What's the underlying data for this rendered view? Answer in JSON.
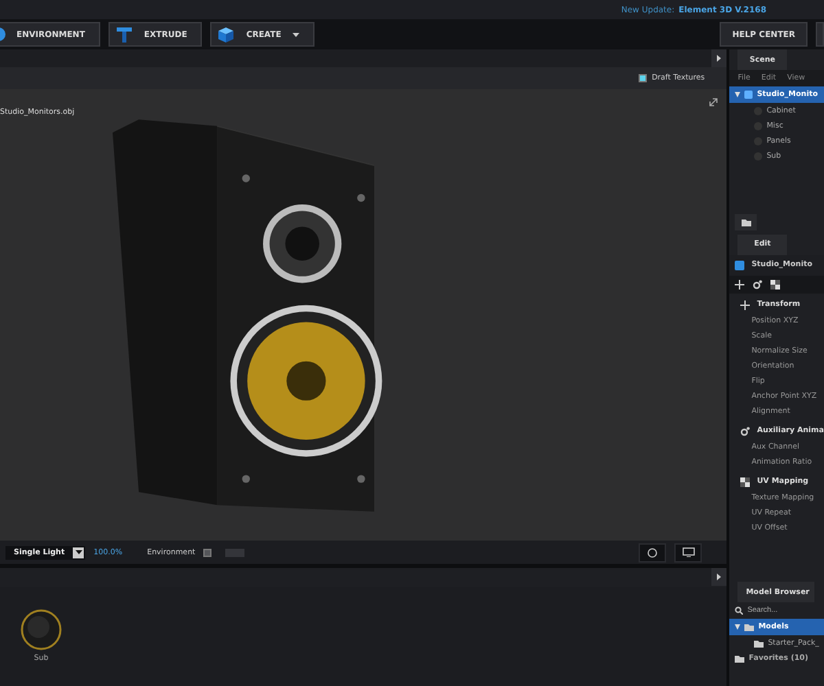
{
  "update": {
    "label": "New Update:",
    "version": "Element 3D V.2168"
  },
  "toolbar": [
    {
      "label": "ENVIRONMENT",
      "kind": "globe",
      "dropdown": false
    },
    {
      "label": "EXTRUDE",
      "kind": "extrude",
      "dropdown": false
    },
    {
      "label": "CREATE",
      "kind": "cube",
      "dropdown": true
    }
  ],
  "help": "HELP CENTER",
  "viewport": {
    "draft_textures": {
      "label": "Draft Textures",
      "checked": true
    },
    "object_label": "Studio_Monitors.obj",
    "light": "Single Light",
    "intensity": "100.0%",
    "environment": {
      "label": "Environment",
      "checked": false
    }
  },
  "materials": [
    {
      "name": "Sub"
    }
  ],
  "scene": {
    "tab": "Scene",
    "menu": [
      "File",
      "Edit",
      "View"
    ],
    "tree": [
      {
        "label": "Studio_Monito",
        "selected": true,
        "expanded": true,
        "children": [
          {
            "label": "Cabinet",
            "selected": false
          },
          {
            "label": "Misc",
            "selected": false
          },
          {
            "label": "Panels",
            "selected": false
          },
          {
            "label": "Sub",
            "selected": false
          }
        ]
      }
    ]
  },
  "edit": {
    "tab": "Edit",
    "object": "Studio_Monito",
    "sections": [
      {
        "title": "Transform",
        "kind": "move",
        "items": [
          "Position XYZ",
          "Scale",
          "Normalize Size",
          "Orientation",
          "Flip",
          "Anchor Point XYZ",
          "Alignment"
        ]
      },
      {
        "title": "Auxiliary Anima",
        "kind": "gears",
        "items": [
          "Aux Channel",
          "Animation Ratio"
        ]
      },
      {
        "title": "UV Mapping",
        "kind": "checker",
        "items": [
          "Texture Mapping",
          "UV Repeat",
          "UV Offset"
        ]
      }
    ]
  },
  "model_browser": {
    "tab": "Model Browser",
    "placeholder": "Search...",
    "tree": [
      {
        "label": "Models",
        "selected": true,
        "expanded": true,
        "children": [
          {
            "label": "Starter_Pack_",
            "selected": false
          }
        ]
      },
      {
        "label": "Favorites (10)",
        "selected": false
      }
    ]
  }
}
